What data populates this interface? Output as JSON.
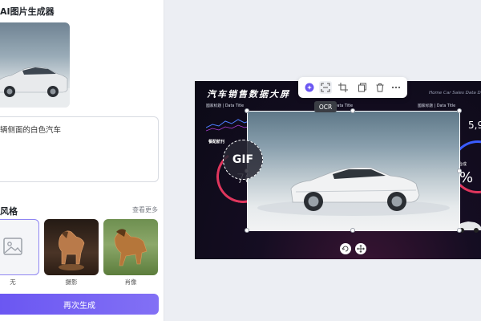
{
  "panel": {
    "title": "AI图片生成器",
    "prompt": "辆侧面的白色汽车",
    "style_label": "风格",
    "more": "查看更多",
    "styles": [
      {
        "caption": "无"
      },
      {
        "caption": "摄影"
      },
      {
        "caption": "肖像"
      }
    ],
    "regen_button": "再次生成"
  },
  "dashboard": {
    "title": "汽车销售数据大屏",
    "subtitle_en": "Home Car Sales Data D",
    "chips": [
      "國家标题 | Data Title",
      "國家标题 | Data Title",
      "國家标题 | Data Title"
    ],
    "section_label": "餐配航刊",
    "pct_left": "70",
    "num_right": "5,9",
    "pct_right": "%",
    "label_right": "合成"
  },
  "toolbar": {
    "ocr_tooltip": "OCR",
    "icons": [
      "ai-magic-icon",
      "ocr-scan-icon",
      "crop-icon",
      "copy-icon",
      "delete-icon",
      "more-icon"
    ]
  },
  "badge": {
    "label": "GIF"
  },
  "colors": {
    "accent": "#6b57f2",
    "selection": "#8f85f2",
    "dashboard_bg": "#0b0a16"
  }
}
